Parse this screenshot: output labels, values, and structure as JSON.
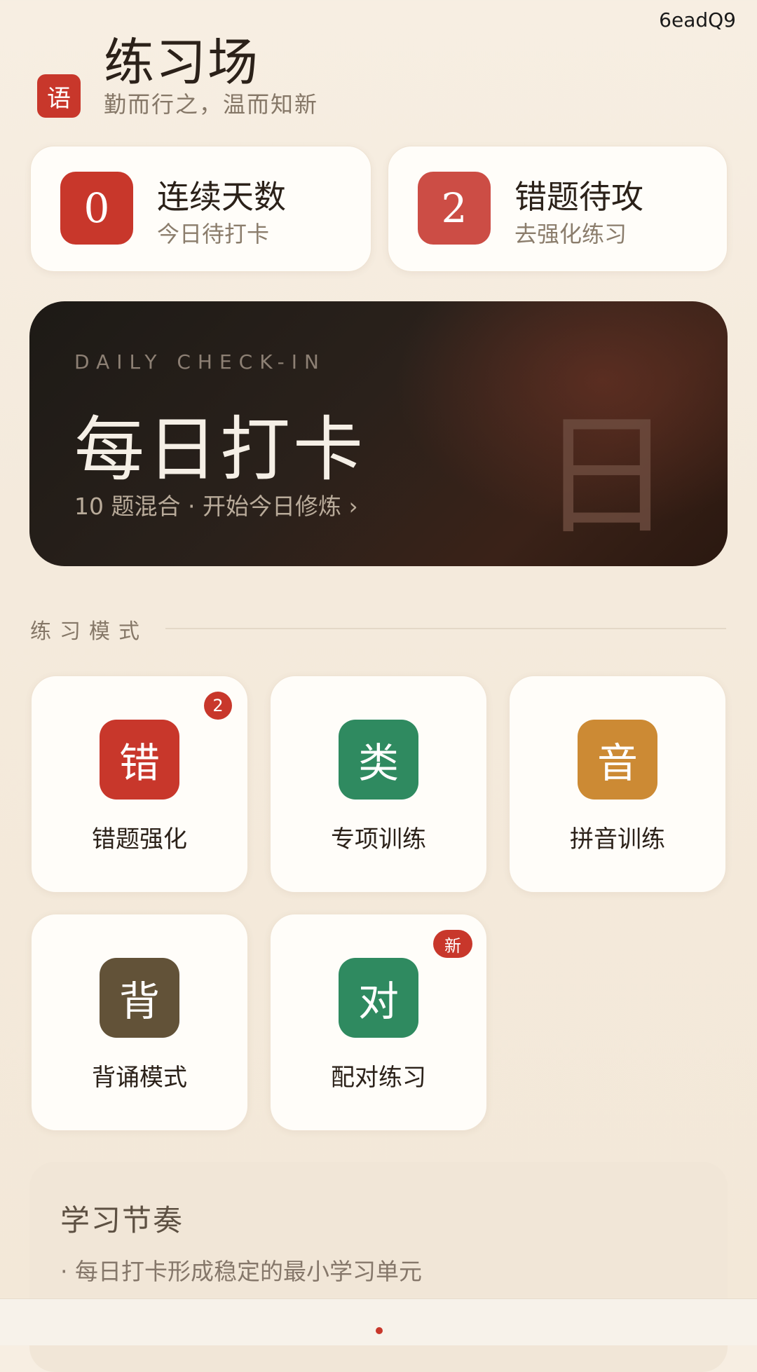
{
  "corner_id": "6eadQ9",
  "header": {
    "logo_char": "语",
    "title": "练习场",
    "subtitle": "勤而行之，温而知新"
  },
  "stats": [
    {
      "value": "0",
      "title": "连续天数",
      "sub": "今日待打卡",
      "color": "#c8372b"
    },
    {
      "value": "2",
      "title": "错题待攻",
      "sub": "去强化练习",
      "color": "#cc4d45"
    }
  ],
  "banner": {
    "kicker": "DAILY CHECK-IN",
    "title": "每日打卡",
    "sub": "10 题混合 · 开始今日修炼 ›",
    "watermark": "日"
  },
  "section": {
    "label": "练习模式"
  },
  "modes": [
    {
      "char": "错",
      "label": "错题强化",
      "badge": "2",
      "color": "#c8372b"
    },
    {
      "char": "类",
      "label": "专项训练",
      "badge": "",
      "color": "#2f8a60"
    },
    {
      "char": "音",
      "label": "拼音训练",
      "badge": "",
      "color": "#cc8a34"
    },
    {
      "char": "背",
      "label": "背诵模式",
      "badge": "",
      "color": "#625238"
    },
    {
      "char": "对",
      "label": "配对练习",
      "badge": "新",
      "color": "#2f8a60"
    }
  ],
  "rhythm": {
    "title": "学习节奏",
    "items": [
      "· 每日打卡形成稳定的最小学习单元"
    ]
  },
  "colors": {
    "accent": "#c8372b",
    "background": "#f4eadc",
    "card": "#fffdf9"
  }
}
